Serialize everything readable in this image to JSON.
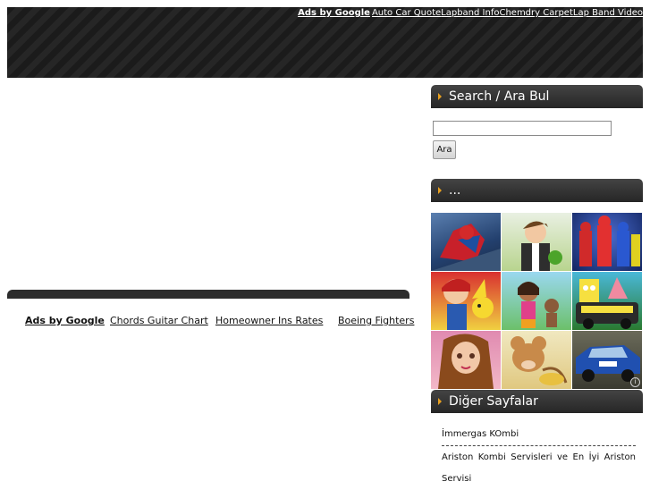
{
  "header": {
    "ads_label": "Ads by Google",
    "ad_links": [
      "Auto Car Quote",
      "Lapband Info",
      "Chemdry Carpet",
      "Lap Band Video"
    ]
  },
  "main": {
    "ads_label": "Ads by Google",
    "ad_links": [
      "Chords Guitar Chart",
      "Homeowner Ins Rates",
      "Boeing Fighters"
    ]
  },
  "sidebar": {
    "search": {
      "title": "Search / Ara Bul",
      "input_value": "",
      "button_label": "Ara"
    },
    "games": {
      "title": "...",
      "tiles": [
        "spiderman",
        "ben-10",
        "power-rangers",
        "pokemon",
        "dora",
        "spongebob",
        "bratz",
        "tom-and-jerry",
        "rally-car"
      ]
    },
    "pages": {
      "title": "Diğer Sayfalar",
      "items": [
        "İmmergas KOmbi",
        "Ariston Kombi Servisleri ve En İyi Ariston Servisi"
      ]
    }
  },
  "colors": {
    "header_bg": "#1f1f1f",
    "sidebar_head": "#333333",
    "accent_arrow": "#e8a020"
  }
}
